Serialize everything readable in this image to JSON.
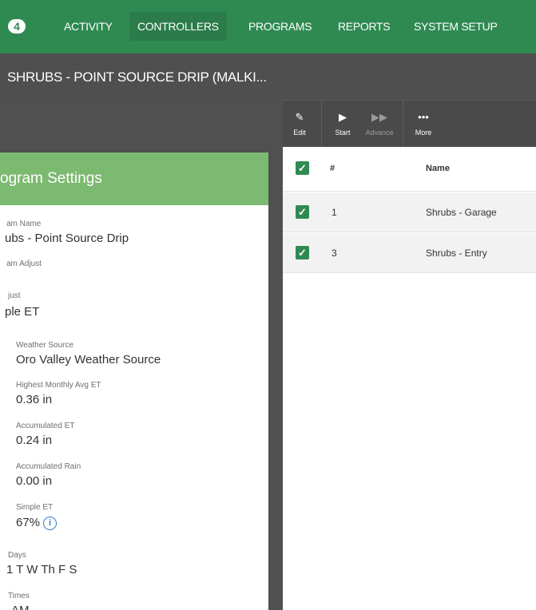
{
  "nav": {
    "logo": "4",
    "items": [
      "ACTIVITY",
      "CONTROLLERS",
      "PROGRAMS",
      "REPORTS",
      "SYSTEM SETUP"
    ],
    "active": "CONTROLLERS"
  },
  "subheader": {
    "title": "SHRUBS - POINT SOURCE DRIP (MALKI..."
  },
  "card": {
    "title": "ogram Settings",
    "fields": {
      "program_name_label": "am Name",
      "program_name_value": "ubs - Point Source Drip",
      "program_adjust_label": "am Adjust",
      "adjust_label": "just",
      "adjust_value": "ple ET",
      "weather_source_label": "Weather Source",
      "weather_source_value": "Oro Valley Weather Source",
      "highest_et_label": "Highest Monthly Avg ET",
      "highest_et_value": "0.36 in",
      "accum_et_label": "Accumulated ET",
      "accum_et_value": "0.24 in",
      "accum_rain_label": "Accumulated Rain",
      "accum_rain_value": "0.00 in",
      "simple_et_label": "Simple ET",
      "simple_et_value": "67%",
      "days_label": "Days",
      "days_value": "1 T W Th F S",
      "times_label": "Times",
      "times_value": "AM"
    }
  },
  "toolbar": {
    "edit": "Edit",
    "start": "Start",
    "advance": "Advance",
    "more": "More"
  },
  "table": {
    "headers": {
      "num": "#",
      "name": "Name"
    },
    "rows": [
      {
        "num": "1",
        "name": "Shrubs - Garage"
      },
      {
        "num": "3",
        "name": "Shrubs - Entry"
      }
    ]
  },
  "icons": {
    "checkbox": "checkmark-icon",
    "info": "info-icon",
    "edit": "pencil-icon",
    "start": "play-icon",
    "advance": "fast-forward-icon",
    "more": "ellipsis-icon"
  },
  "colors": {
    "nav_bg": "#2f8a52",
    "card_header": "#7cb971",
    "checkbox": "#2f8a52",
    "info": "#2f7fd0"
  }
}
